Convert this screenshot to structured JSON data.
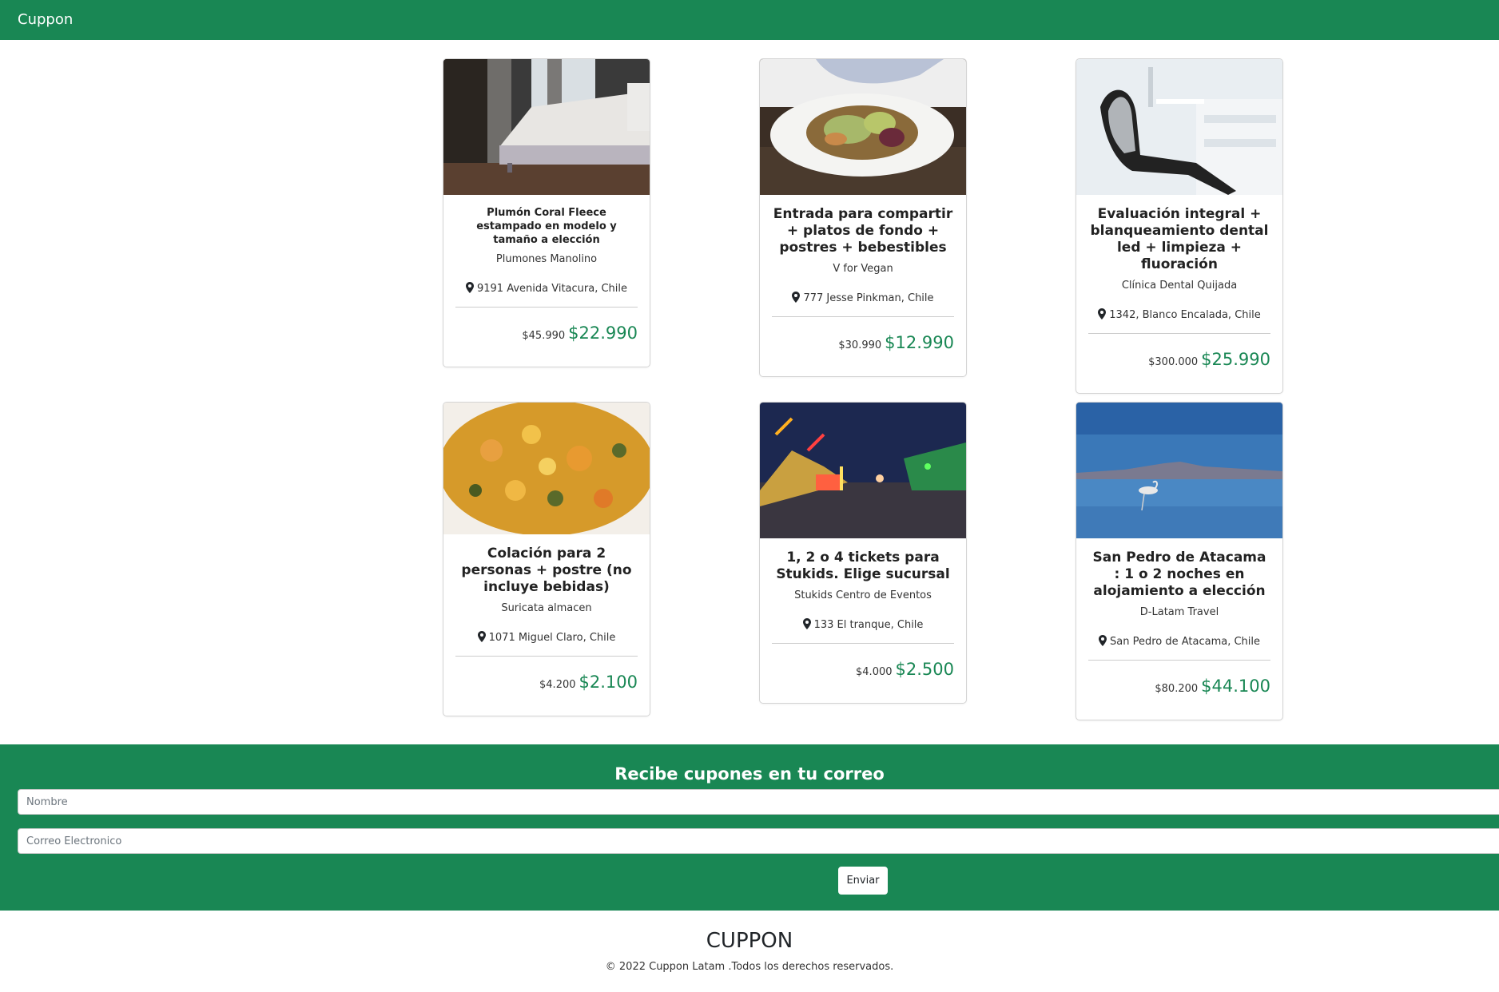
{
  "navbar": {
    "brand": "Cuppon"
  },
  "deals": [
    {
      "title": "Plumón Coral Fleece estampado en modelo y tamaño a elección",
      "vendor": "Plumones Manolino",
      "location": "9191 Avenida Vitacura, Chile",
      "old_price": "$45.990",
      "new_price": "$22.990",
      "image": "bedroom-photo"
    },
    {
      "title": "Entrada para compartir + platos de fondo + postres + bebestibles",
      "vendor": "V for Vegan",
      "location": "777 Jesse Pinkman, Chile",
      "old_price": "$30.990",
      "new_price": "$12.990",
      "image": "salad-plate-photo"
    },
    {
      "title": "Evaluación integral + blanqueamiento dental led + limpieza + fluoración",
      "vendor": "Clínica Dental Quijada",
      "location": "1342, Blanco Encalada, Chile",
      "old_price": "$300.000",
      "new_price": "$25.990",
      "image": "dental-chair-photo"
    },
    {
      "title": "Colación para 2 personas + postre (no incluye bebidas)",
      "vendor": "Suricata almacen",
      "location": "1071 Miguel Claro, Chile",
      "old_price": "$4.200",
      "new_price": "$2.100",
      "image": "stew-photo"
    },
    {
      "title": "1, 2 o 4 tickets para Stukids. Elige sucursal",
      "vendor": "Stukids Centro de Eventos",
      "location": "133 El tranque, Chile",
      "old_price": "$4.000",
      "new_price": "$2.500",
      "image": "fairground-photo"
    },
    {
      "title": "San Pedro de Atacama : 1 o 2 noches en alojamiento a elección",
      "vendor": "D-Latam Travel",
      "location": "San Pedro de Atacama, Chile",
      "old_price": "$80.200",
      "new_price": "$44.100",
      "image": "flamingo-lagoon-photo"
    }
  ],
  "subscribe": {
    "title": "Recibe cupones en tu correo",
    "name_placeholder": "Nombre",
    "email_placeholder": "Correo Electronico",
    "button": "Enviar"
  },
  "footer": {
    "brand": "CUPPON",
    "copyright": "© 2022 Cuppon Latam .Todos los derechos reservados."
  },
  "colors": {
    "brand_green": "#198754",
    "price_green": "#198754"
  },
  "icons": {
    "location": "map-pin-icon"
  }
}
